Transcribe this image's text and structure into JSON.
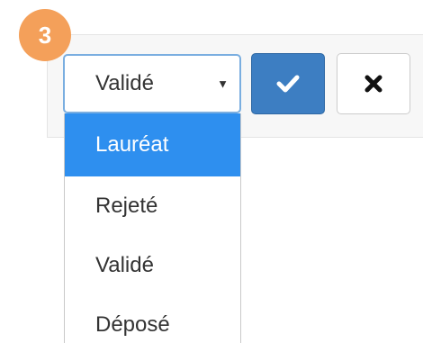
{
  "step_badge": {
    "number": "3",
    "color": "#f4a05a"
  },
  "status_select": {
    "selected_value": "Validé",
    "caret_icon": "caret-down-icon"
  },
  "confirm_button": {
    "icon": "check-icon",
    "color": "#3d7ec2"
  },
  "cancel_button": {
    "icon": "close-icon"
  },
  "dropdown": {
    "highlight_color": "#2e8fef",
    "options": [
      {
        "label": "Lauréat",
        "highlighted": true
      },
      {
        "label": "Rejeté",
        "highlighted": false
      },
      {
        "label": "Validé",
        "highlighted": false
      },
      {
        "label": "Déposé",
        "highlighted": false
      }
    ]
  }
}
